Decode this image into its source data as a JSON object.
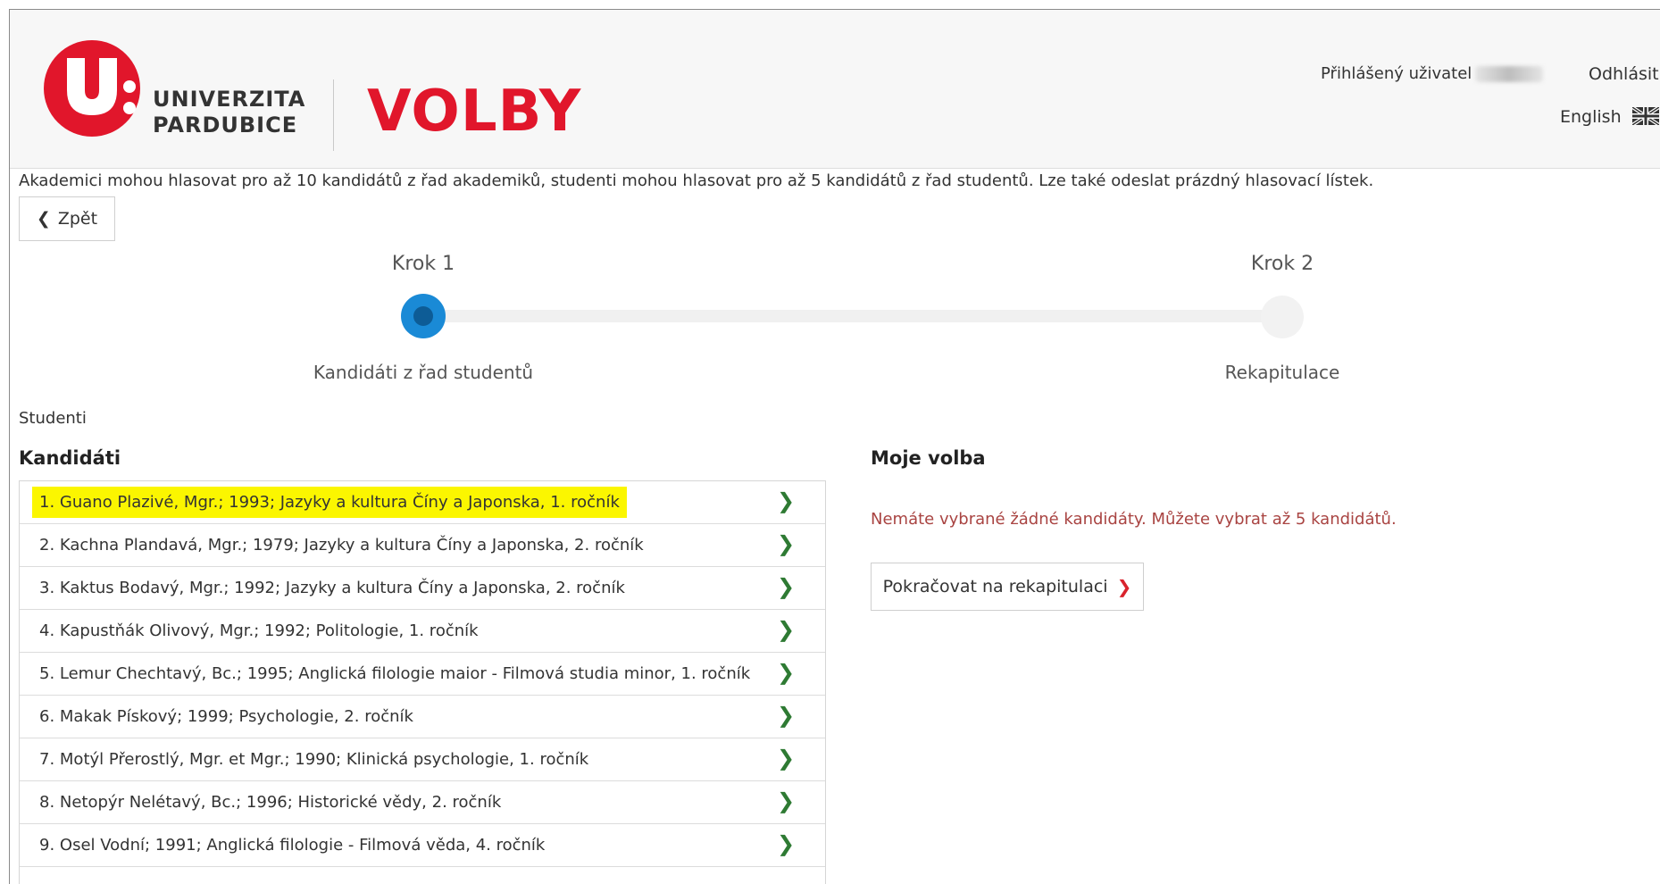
{
  "header": {
    "university_line1": "UNIVERZITA",
    "university_line2": "PARDUBICE",
    "app_title": "VOLBY",
    "logged_user_label": "Přihlášený uživatel",
    "logout_label": "Odhlásit",
    "language_label": "English"
  },
  "intro_text": "Akademici mohou hlasovat pro až 10 kandidátů z řad akademiků, studenti mohou hlasovat pro až 5 kandidátů z řad studentů. Lze také odeslat prázdný hlasovací lístek.",
  "back_button_label": "Zpět",
  "stepper": {
    "steps": [
      {
        "label": "Krok 1",
        "sub": "Kandidáti z řad studentů",
        "active": true
      },
      {
        "label": "Krok 2",
        "sub": "Rekapitulace",
        "active": false
      }
    ]
  },
  "section_label": "Studenti",
  "candidates_title": "Kandidáti",
  "candidates": [
    "1. Guano Plazivé, Mgr.; 1993; Jazyky a kultura Číny a Japonska, 1. ročník",
    "2. Kachna Plandavá, Mgr.; 1979; Jazyky a kultura Číny a Japonska, 2. ročník",
    "3. Kaktus Bodavý, Mgr.; 1992; Jazyky a kultura Číny a Japonska, 2. ročník",
    "4. Kapustňák Olivový, Mgr.; 1992; Politologie, 1. ročník",
    "5. Lemur Chechtavý, Bc.; 1995; Anglická filologie maior - Filmová studia minor, 1. ročník",
    "6. Makak Pískový; 1999; Psychologie, 2. ročník",
    "7. Motýl Přerostlý, Mgr. et Mgr.; 1990; Klinická psychologie, 1. ročník",
    "8. Netopýr Nelétavý, Bc.; 1996; Historické vědy, 2. ročník",
    "9. Osel Vodní; 1991; Anglická filologie - Filmová věda, 4. ročník"
  ],
  "my_choice": {
    "title": "Moje volba",
    "empty_message": "Nemáte vybrané žádné kandidáty. Můžete vybrat až 5 kandidátů.",
    "continue_label": "Pokračovat na rekapitulaci"
  },
  "colors": {
    "brand_red": "#e1162b",
    "active_step": "#1a8ad6",
    "highlight": "#fbf600",
    "chevron_green": "#2e7a33",
    "error_text": "#a94442"
  }
}
